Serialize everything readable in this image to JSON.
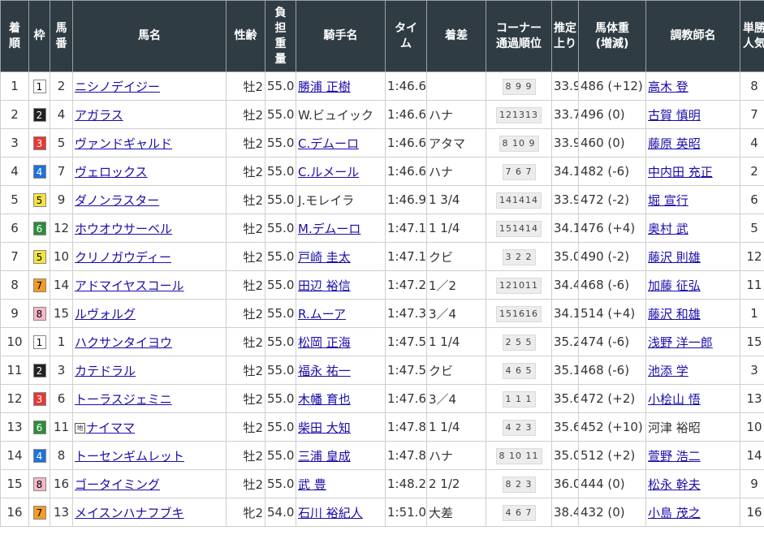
{
  "headers": {
    "rank": "着順",
    "waku": "枠",
    "umaban": "馬番",
    "horse": "馬名",
    "sexage": "性齢",
    "weight": "負担重量",
    "jockey": "騎手名",
    "time": "タイム",
    "margin": "着差",
    "corner": "コーナー通過順位",
    "last3f": "推定上り",
    "body": "馬体重",
    "body_sub": "(増減)",
    "trainer": "調教師名",
    "pop": "単勝人気"
  },
  "waku_colors": {
    "1": {
      "bg": "#ffffff",
      "fg": "#000000"
    },
    "2": {
      "bg": "#222222",
      "fg": "#ffffff"
    },
    "3": {
      "bg": "#e53935",
      "fg": "#ffffff"
    },
    "4": {
      "bg": "#1e73d6",
      "fg": "#ffffff"
    },
    "5": {
      "bg": "#f5e43a",
      "fg": "#000000"
    },
    "6": {
      "bg": "#2e8b3a",
      "fg": "#ffffff"
    },
    "7": {
      "bg": "#f39c22",
      "fg": "#000000"
    },
    "8": {
      "bg": "#f7b7c9",
      "fg": "#000000"
    }
  },
  "rows": [
    {
      "rank": "1",
      "waku": "1",
      "umaban": "2",
      "horse": "ニシノデイジー",
      "chiho": false,
      "sexage": "牡2",
      "weight": "55.0",
      "jockey": "勝浦 正樹",
      "jockey_link": true,
      "time": "1:46.6",
      "margin": "",
      "corner": "8 9 9",
      "last3f": "33.9",
      "body": "486 (+12)",
      "trainer": "高木 登",
      "trainer_link": true,
      "pop": "8"
    },
    {
      "rank": "2",
      "waku": "2",
      "umaban": "4",
      "horse": "アガラス",
      "chiho": false,
      "sexage": "牡2",
      "weight": "55.0",
      "jockey": "W.ビュイック",
      "jockey_link": false,
      "time": "1:46.6",
      "margin": "ハナ",
      "corner": "121313",
      "last3f": "33.7",
      "body": "496 (0)",
      "trainer": "古賀 慎明",
      "trainer_link": true,
      "pop": "7"
    },
    {
      "rank": "3",
      "waku": "3",
      "umaban": "5",
      "horse": "ヴァンドギャルド",
      "chiho": false,
      "sexage": "牡2",
      "weight": "55.0",
      "jockey": "C.デムーロ",
      "jockey_link": true,
      "time": "1:46.6",
      "margin": "アタマ",
      "corner": "8 10 9",
      "last3f": "33.9",
      "body": "460 (0)",
      "trainer": "藤原 英昭",
      "trainer_link": true,
      "pop": "4"
    },
    {
      "rank": "4",
      "waku": "4",
      "umaban": "7",
      "horse": "ヴェロックス",
      "chiho": false,
      "sexage": "牡2",
      "weight": "55.0",
      "jockey": "C.ルメール",
      "jockey_link": true,
      "time": "1:46.6",
      "margin": "ハナ",
      "corner": "7 6 7",
      "last3f": "34.1",
      "body": "482 (-6)",
      "trainer": "中内田 充正",
      "trainer_link": true,
      "pop": "2"
    },
    {
      "rank": "5",
      "waku": "5",
      "umaban": "9",
      "horse": "ダノンラスター",
      "chiho": false,
      "sexage": "牡2",
      "weight": "55.0",
      "jockey": "J.モレイラ",
      "jockey_link": false,
      "time": "1:46.9",
      "margin": "1 3/4",
      "corner": "141414",
      "last3f": "33.9",
      "body": "472 (-2)",
      "trainer": "堀 宣行",
      "trainer_link": true,
      "pop": "6"
    },
    {
      "rank": "6",
      "waku": "6",
      "umaban": "12",
      "horse": "ホウオウサーベル",
      "chiho": false,
      "sexage": "牡2",
      "weight": "55.0",
      "jockey": "M.デムーロ",
      "jockey_link": true,
      "time": "1:47.1",
      "margin": "1 1/4",
      "corner": "151414",
      "last3f": "34.1",
      "body": "476 (+4)",
      "trainer": "奥村 武",
      "trainer_link": true,
      "pop": "5"
    },
    {
      "rank": "7",
      "waku": "5",
      "umaban": "10",
      "horse": "クリノガウディー",
      "chiho": false,
      "sexage": "牡2",
      "weight": "55.0",
      "jockey": "戸崎 圭太",
      "jockey_link": true,
      "time": "1:47.1",
      "margin": "クビ",
      "corner": "3 2 2",
      "last3f": "35.0",
      "body": "490 (-2)",
      "trainer": "藤沢 則雄",
      "trainer_link": true,
      "pop": "12"
    },
    {
      "rank": "8",
      "waku": "7",
      "umaban": "14",
      "horse": "アドマイヤスコール",
      "chiho": false,
      "sexage": "牡2",
      "weight": "55.0",
      "jockey": "田辺 裕信",
      "jockey_link": true,
      "time": "1:47.2",
      "margin": "1／2",
      "corner": "121011",
      "last3f": "34.4",
      "body": "468 (-6)",
      "trainer": "加藤 征弘",
      "trainer_link": true,
      "pop": "11"
    },
    {
      "rank": "9",
      "waku": "8",
      "umaban": "15",
      "horse": "ルヴォルグ",
      "chiho": false,
      "sexage": "牡2",
      "weight": "55.0",
      "jockey": "R.ムーア",
      "jockey_link": true,
      "time": "1:47.3",
      "margin": "3／4",
      "corner": "151616",
      "last3f": "34.1",
      "body": "514 (+4)",
      "trainer": "藤沢 和雄",
      "trainer_link": true,
      "pop": "1"
    },
    {
      "rank": "10",
      "waku": "1",
      "umaban": "1",
      "horse": "ハクサンタイヨウ",
      "chiho": false,
      "sexage": "牡2",
      "weight": "55.0",
      "jockey": "松岡 正海",
      "jockey_link": true,
      "time": "1:47.5",
      "margin": "1 1/4",
      "corner": "2 5 5",
      "last3f": "35.2",
      "body": "474 (-6)",
      "trainer": "浅野 洋一郎",
      "trainer_link": true,
      "pop": "15"
    },
    {
      "rank": "11",
      "waku": "2",
      "umaban": "3",
      "horse": "カテドラル",
      "chiho": false,
      "sexage": "牡2",
      "weight": "55.0",
      "jockey": "福永 祐一",
      "jockey_link": true,
      "time": "1:47.5",
      "margin": "クビ",
      "corner": "4 6 5",
      "last3f": "35.1",
      "body": "468 (-6)",
      "trainer": "池添 学",
      "trainer_link": true,
      "pop": "3"
    },
    {
      "rank": "12",
      "waku": "3",
      "umaban": "6",
      "horse": "トーラスジェミニ",
      "chiho": false,
      "sexage": "牡2",
      "weight": "55.0",
      "jockey": "木幡 育也",
      "jockey_link": true,
      "time": "1:47.6",
      "margin": "3／4",
      "corner": "1 1 1",
      "last3f": "35.6",
      "body": "472 (+2)",
      "trainer": "小桧山 悟",
      "trainer_link": true,
      "pop": "13"
    },
    {
      "rank": "13",
      "waku": "6",
      "umaban": "11",
      "horse": "ナイママ",
      "chiho": true,
      "sexage": "牡2",
      "weight": "55.0",
      "jockey": "柴田 大知",
      "jockey_link": true,
      "time": "1:47.8",
      "margin": "1 1/4",
      "corner": "4 2 3",
      "last3f": "35.6",
      "body": "452 (+10)",
      "trainer": "河津 裕昭",
      "trainer_link": false,
      "pop": "10"
    },
    {
      "rank": "14",
      "waku": "4",
      "umaban": "8",
      "horse": "トーセンギムレット",
      "chiho": false,
      "sexage": "牡2",
      "weight": "55.0",
      "jockey": "三浦 皇成",
      "jockey_link": true,
      "time": "1:47.8",
      "margin": "ハナ",
      "corner": "8 10 11",
      "last3f": "35.0",
      "body": "512 (+2)",
      "trainer": "萱野 浩二",
      "trainer_link": true,
      "pop": "14"
    },
    {
      "rank": "15",
      "waku": "8",
      "umaban": "16",
      "horse": "ゴータイミング",
      "chiho": false,
      "sexage": "牡2",
      "weight": "55.0",
      "jockey": "武 豊",
      "jockey_link": true,
      "time": "1:48.2",
      "margin": "2 1/2",
      "corner": "8 2 3",
      "last3f": "36.0",
      "body": "444 (0)",
      "trainer": "松永 幹夫",
      "trainer_link": true,
      "pop": "9"
    },
    {
      "rank": "16",
      "waku": "7",
      "umaban": "13",
      "horse": "メイスンハナフブキ",
      "chiho": false,
      "sexage": "牝2",
      "weight": "54.0",
      "jockey": "石川 裕紀人",
      "jockey_link": true,
      "time": "1:51.0",
      "margin": "大差",
      "corner": "4 6 7",
      "last3f": "38.4",
      "body": "432 (0)",
      "trainer": "小島 茂之",
      "trainer_link": true,
      "pop": "16"
    }
  ],
  "chiho_mark": "地"
}
